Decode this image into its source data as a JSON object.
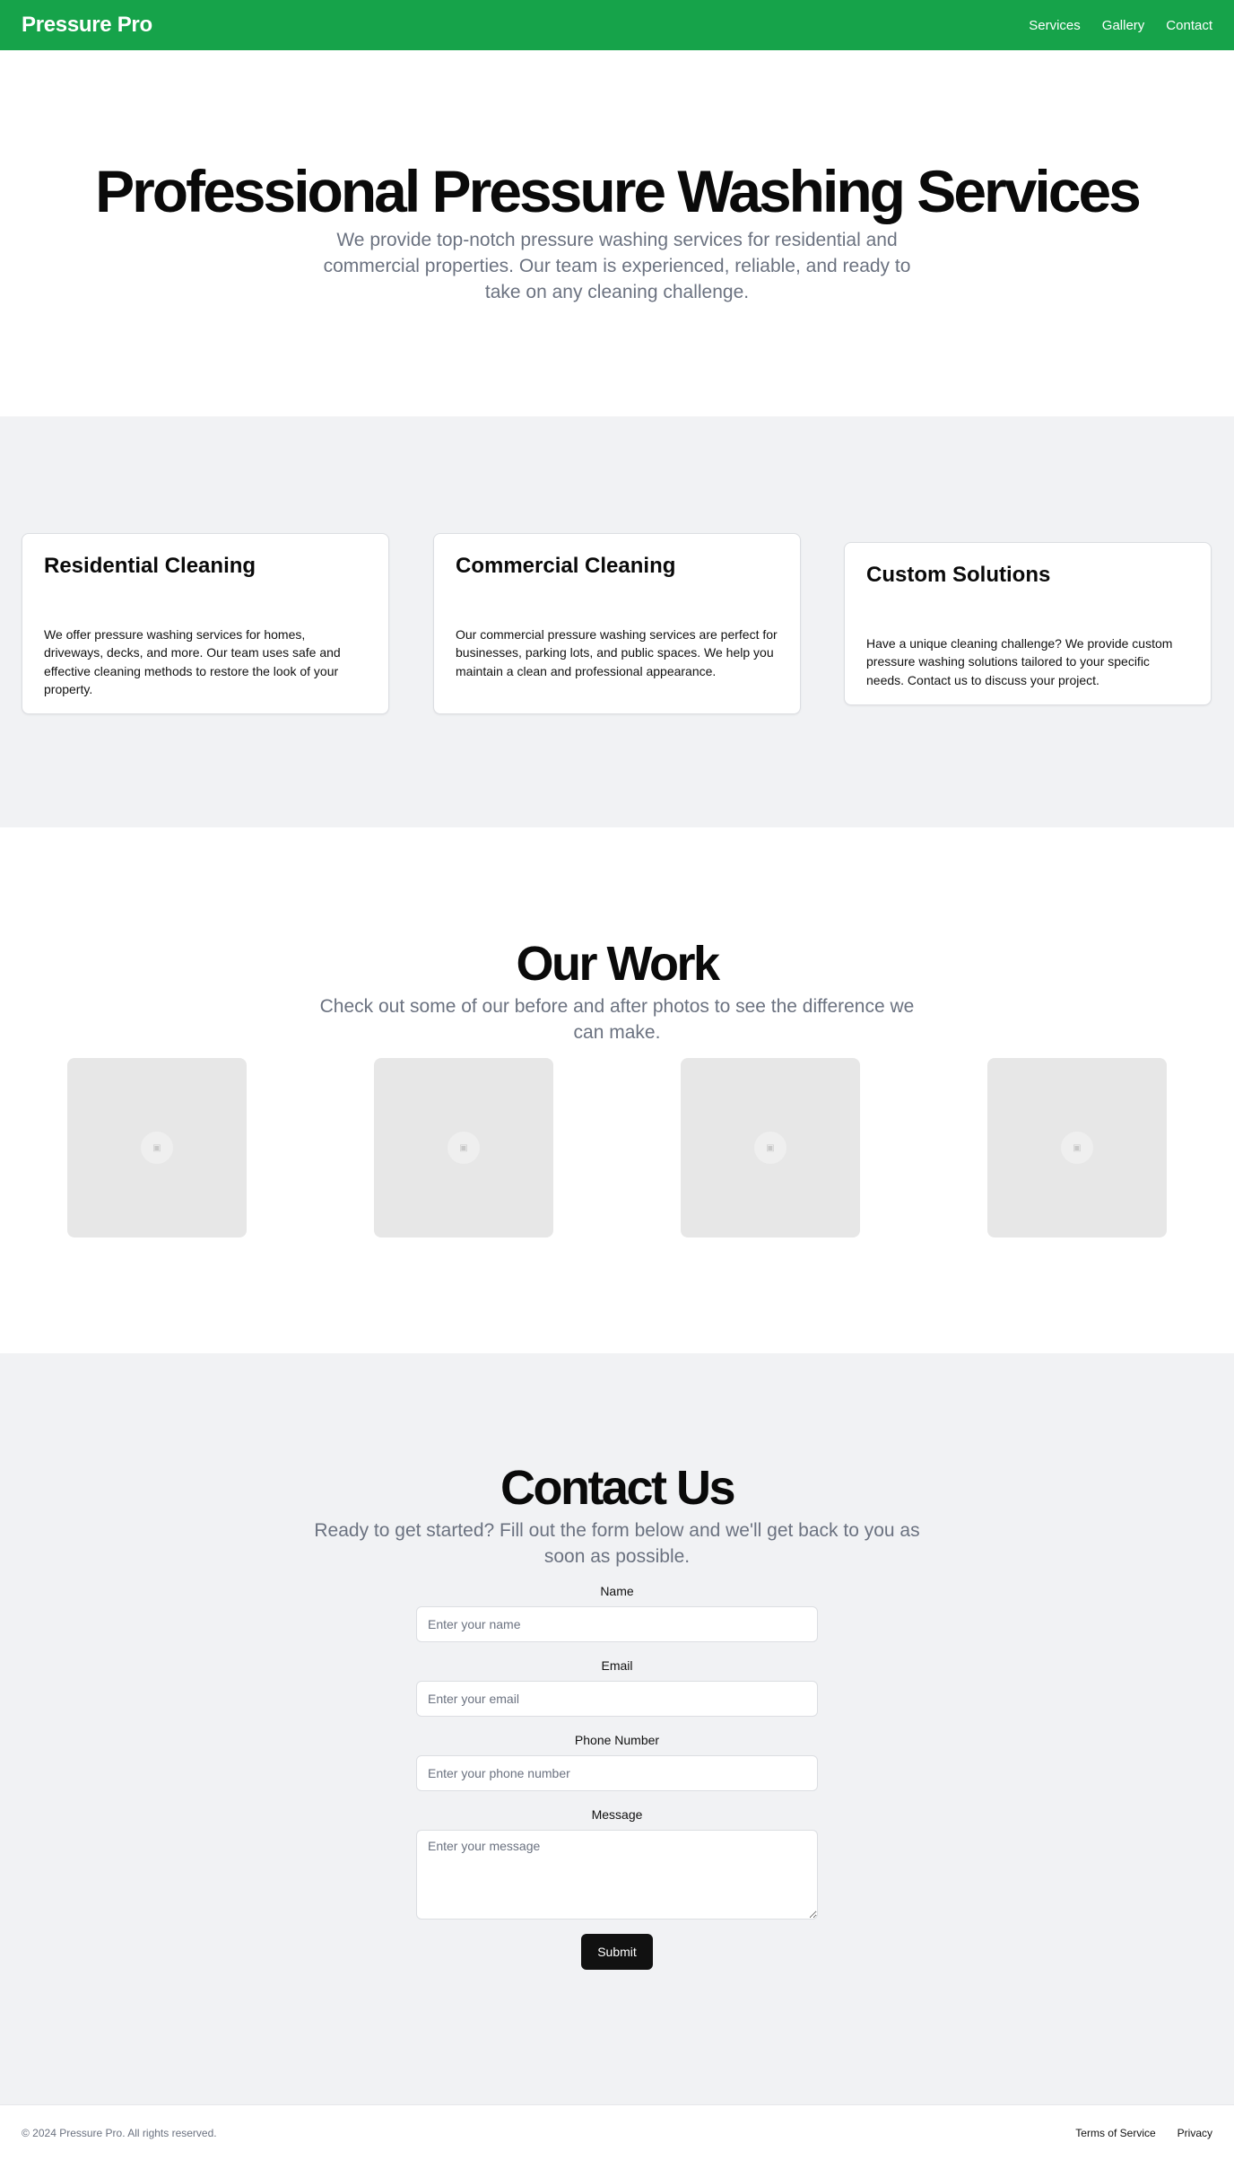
{
  "header": {
    "brand": "Pressure Pro",
    "nav": [
      "Services",
      "Gallery",
      "Contact"
    ]
  },
  "hero": {
    "title": "Professional Pressure Washing Services",
    "subtitle": "We provide top-notch pressure washing services for residential and commercial properties. Our team is experienced, reliable, and ready to take on any cleaning challenge."
  },
  "services": [
    {
      "title": "Residential Cleaning",
      "body": "We offer pressure washing services for homes, driveways, decks, and more. Our team uses safe and effective cleaning methods to restore the look of your property."
    },
    {
      "title": "Commercial Cleaning",
      "body": "Our commercial pressure washing services are perfect for businesses, parking lots, and public spaces. We help you maintain a clean and professional appearance."
    },
    {
      "title": "Custom Solutions",
      "body": "Have a unique cleaning challenge? We provide custom pressure washing solutions tailored to your specific needs. Contact us to discuss your project."
    }
  ],
  "work": {
    "title": "Our Work",
    "subtitle": "Check out some of our before and after photos to see the difference we can make.",
    "photo_icon": "broken-image-icon"
  },
  "contact": {
    "title": "Contact Us",
    "subtitle": "Ready to get started? Fill out the form below and we'll get back to you as soon as possible.",
    "fields": [
      {
        "label": "Name",
        "placeholder": "Enter your name",
        "value": ""
      },
      {
        "label": "Email",
        "placeholder": "Enter your email",
        "value": ""
      },
      {
        "label": "Phone Number",
        "placeholder": "Enter your phone number",
        "value": ""
      },
      {
        "label": "Message",
        "placeholder": "Enter your message",
        "value": ""
      }
    ],
    "submit_label": "Submit"
  },
  "footer": {
    "copyright": "© 2024 Pressure Pro. All rights reserved.",
    "links": [
      "Terms of Service",
      "Privacy"
    ]
  },
  "colors": {
    "header_bg": "#16a34a",
    "section_alt_bg": "#f1f2f4",
    "muted_text": "#6b7280",
    "button_bg": "#111111"
  }
}
